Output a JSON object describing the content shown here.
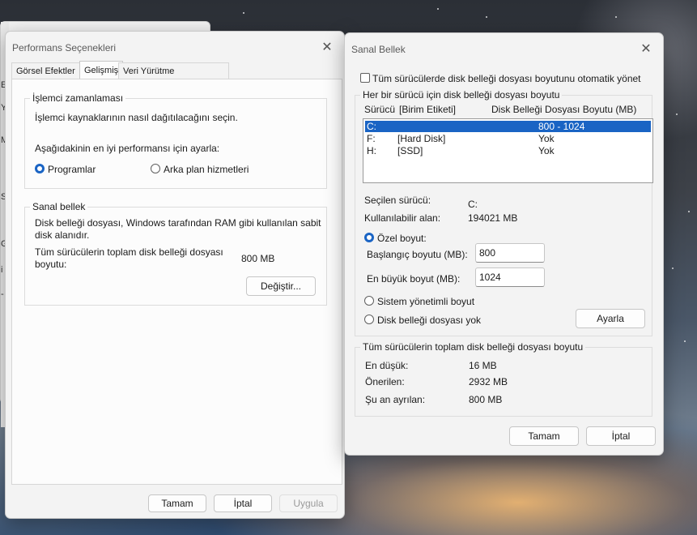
{
  "back_window": {
    "fragments": [
      "Eli",
      "Yö",
      "Ma",
      "Sis",
      "Gel",
      "i",
      "-"
    ]
  },
  "perf": {
    "title": "Performans Seçenekleri",
    "tabs": [
      "Görsel Efektler",
      "Gelişmiş",
      "Veri Yürütme Engellemesi"
    ],
    "processor": {
      "group": "İşlemci zamanlaması",
      "desc": "İşlemci kaynaklarının nasıl dağıtılacağını seçin.",
      "adjust": "Aşağıdakinin en iyi performansı için ayarla:",
      "opt_programs": "Programlar",
      "opt_background": "Arka plan hizmetleri"
    },
    "virtual": {
      "group": "Sanal bellek",
      "desc_line1": "Disk belleği dosyası, Windows tarafından RAM gibi kullanılan sabit",
      "desc_line2": "disk alanıdır.",
      "total_line1": "Tüm sürücülerin toplam disk belleği dosyası",
      "total_line2": "boyutu:",
      "total_value": "800 MB",
      "change_button": "Değiştir..."
    },
    "buttons": {
      "ok": "Tamam",
      "cancel": "İptal",
      "apply": "Uygula"
    }
  },
  "vm": {
    "title": "Sanal Bellek",
    "auto_manage": "Tüm sürücülerde disk belleği dosyası boyutunu otomatik yönet",
    "per_drive_group": "Her bir sürücü için disk belleği dosyası boyutu",
    "col_drive": "Sürücü",
    "col_label": "[Birim Etiketi]",
    "col_size": "Disk Belleği Dosyası Boyutu (MB)",
    "drives": [
      {
        "drive": "C:",
        "label": "",
        "size": "800 - 1024"
      },
      {
        "drive": "F:",
        "label": "[Hard Disk]",
        "size": "Yok"
      },
      {
        "drive": "H:",
        "label": "[SSD]",
        "size": "Yok"
      }
    ],
    "selected_drive_label": "Seçilen sürücü:",
    "selected_drive_value": "C:",
    "available_label": "Kullanılabilir alan:",
    "available_value": "194021 MB",
    "custom_size": "Özel boyut:",
    "initial_label": "Başlangıç boyutu (MB):",
    "initial_value": "800",
    "max_label": "En büyük boyut (MB):",
    "max_value": "1024",
    "system_managed": "Sistem yönetimli boyut",
    "no_paging": "Disk belleği dosyası yok",
    "set_button": "Ayarla",
    "total_group": "Tüm sürücülerin toplam disk belleği dosyası boyutu",
    "min_label": "En düşük:",
    "min_value": "16 MB",
    "recommended_label": "Önerilen:",
    "recommended_value": "2932 MB",
    "allocated_label": "Şu an ayrılan:",
    "allocated_value": "800 MB",
    "ok_button": "Tamam",
    "cancel_button": "İptal"
  }
}
